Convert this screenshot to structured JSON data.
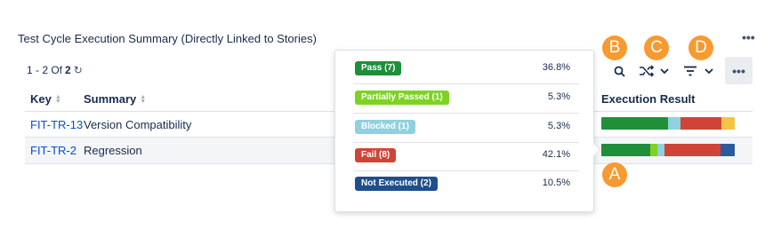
{
  "title": "Test Cycle Execution Summary (Directly Linked to Stories)",
  "pager": {
    "range": "1 - 2 Of",
    "total": "2"
  },
  "columns": {
    "key": "Key",
    "summary": "Summary",
    "execution_result": "Execution Result"
  },
  "rows": [
    {
      "key": "FIT-TR-13",
      "summary": "Version Compatibility",
      "result": [
        {
          "status": "pass",
          "fraction": 0.5
        },
        {
          "status": "blocked",
          "fraction": 0.09
        },
        {
          "status": "fail",
          "fraction": 0.31
        },
        {
          "status": "not_run_yellow",
          "fraction": 0.1
        }
      ]
    },
    {
      "key": "FIT-TR-2",
      "summary": "Regression",
      "result": [
        {
          "status": "pass",
          "fraction": 0.368
        },
        {
          "status": "partially_passed",
          "fraction": 0.053
        },
        {
          "status": "blocked",
          "fraction": 0.053
        },
        {
          "status": "fail",
          "fraction": 0.421
        },
        {
          "status": "not_executed",
          "fraction": 0.105
        }
      ]
    }
  ],
  "popup": {
    "items": [
      {
        "label": "Pass  (7)",
        "percent": "36.8%",
        "color": "#1f8f3a"
      },
      {
        "label": "Partially Passed  (1)",
        "percent": "5.3%",
        "color": "#7ed321"
      },
      {
        "label": "Blocked  (1)",
        "percent": "5.3%",
        "color": "#8fd1e0"
      },
      {
        "label": "Fail  (8)",
        "percent": "42.1%",
        "color": "#d04437"
      },
      {
        "label": "Not Executed  (2)",
        "percent": "10.5%",
        "color": "#1f4e8c"
      }
    ]
  },
  "colors": {
    "pass": "#1f8f3a",
    "partially_passed": "#7ed321",
    "blocked": "#8fd1e0",
    "fail": "#d04437",
    "not_executed": "#2c5a9c",
    "not_run_yellow": "#f4c542",
    "callout": "#f79a2f",
    "link": "#0052cc"
  },
  "icons": [
    "refresh-icon",
    "search-icon",
    "shuffle-icon",
    "chevron-down-icon",
    "filter-icon",
    "more-icon"
  ],
  "callouts": {
    "a": "A",
    "b": "B",
    "c": "C",
    "d": "D"
  }
}
